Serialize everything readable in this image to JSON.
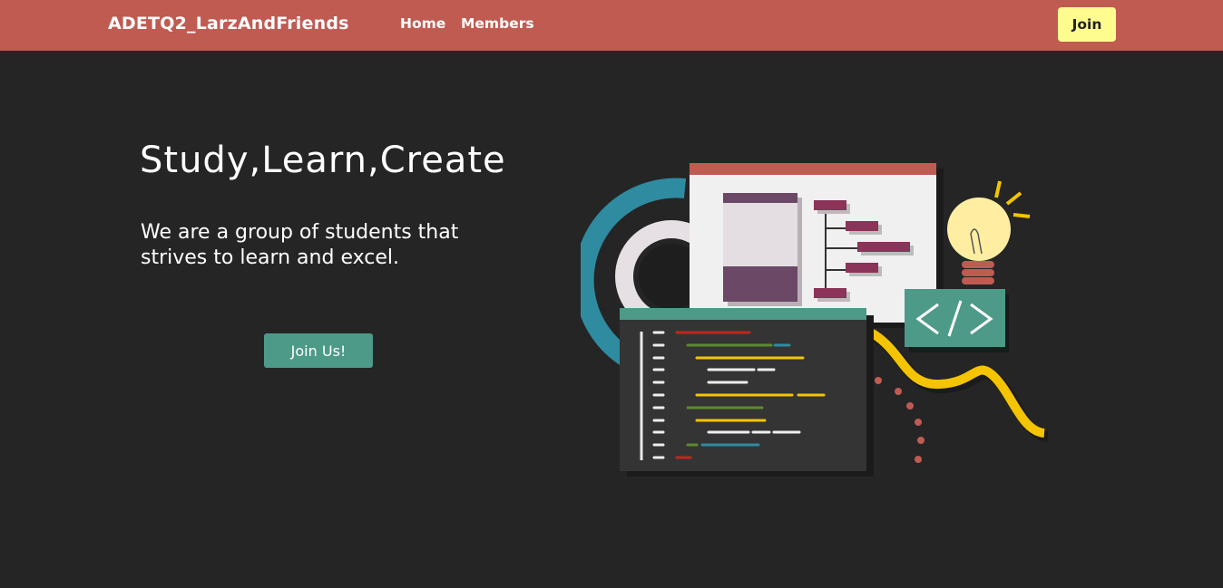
{
  "nav": {
    "brand": "ADETQ2_LarzAndFriends",
    "links": [
      "Home",
      "Members"
    ],
    "join_label": "Join"
  },
  "hero": {
    "title": "Study,Learn,Create",
    "subtitle": "We are a group of students that strives to learn and excel.",
    "cta_label": "Join Us!"
  },
  "illustration": {
    "code_symbol": "</>",
    "icons": [
      "diagram-window-icon",
      "code-editor-icon",
      "lightbulb-icon",
      "code-tag-icon"
    ]
  },
  "colors": {
    "navbar": "#c05b52",
    "background": "#252525",
    "join_button": "#fffc8f",
    "cta_button": "#4d9a88",
    "accent_purple": "#6b4865",
    "accent_yellow": "#f5c400",
    "accent_teal": "#2e8ba0"
  }
}
